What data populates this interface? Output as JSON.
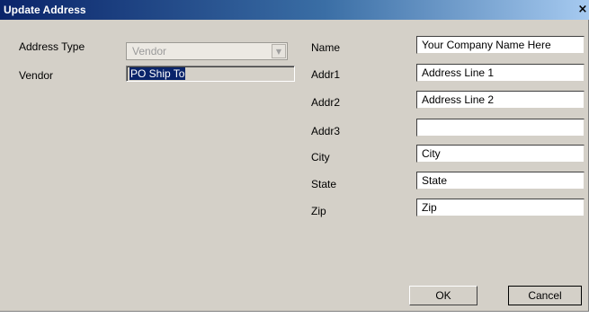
{
  "window": {
    "title": "Update Address",
    "close_glyph": "×"
  },
  "left": {
    "address_type_label": "Address Type",
    "address_type_value": "Vendor",
    "vendor_label": "Vendor",
    "vendor_value": "PO Ship To"
  },
  "fields": [
    {
      "label": "Name",
      "value": "Your Company Name Here"
    },
    {
      "label": "Addr1",
      "value": "Address Line 1"
    },
    {
      "label": "Addr2",
      "value": "Address Line 2"
    },
    {
      "label": "Addr3",
      "value": ""
    },
    {
      "label": "City",
      "value": "City"
    },
    {
      "label": "State",
      "value": "State"
    },
    {
      "label": "Zip",
      "value": "Zip"
    }
  ],
  "buttons": {
    "ok": "OK",
    "cancel": "Cancel"
  },
  "icons": {
    "close": "close-icon",
    "dropdown": "chevron-down-icon"
  }
}
